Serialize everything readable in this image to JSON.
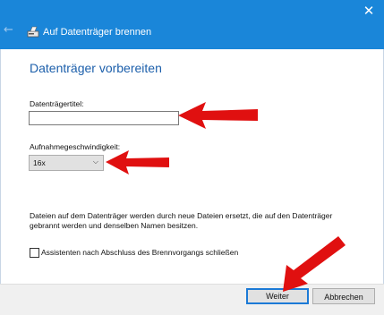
{
  "window": {
    "title": "Auf Datenträger brennen",
    "close_glyph": "✕",
    "back_glyph": "←",
    "icons": [
      "close-icon",
      "back-arrow-icon",
      "burn-disc-icon"
    ]
  },
  "page": {
    "heading": "Datenträger vorbereiten"
  },
  "form": {
    "disc_title_label": "Datenträgertitel:",
    "disc_title_value": "",
    "speed_label": "Aufnahmegeschwindigkeit:",
    "speed_value": "16x",
    "speed_icon": "chevron-down-icon",
    "info_text": "Dateien auf dem Datenträger werden durch neue Dateien ersetzt, die auf den Datenträger gebrannt werden und denselben Namen besitzen.",
    "close_wizard_label": "Assistenten nach Abschluss des Brennvorgangs schließen",
    "close_wizard_checked": false
  },
  "buttons": {
    "next": "Weiter",
    "cancel": "Abbrechen"
  },
  "colors": {
    "titlebar": "#1a86d9",
    "heading": "#1c5fab",
    "annotation_arrow": "#e01010"
  }
}
